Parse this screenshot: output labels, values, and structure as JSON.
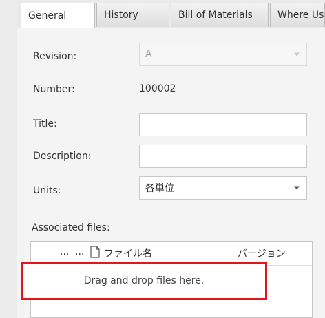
{
  "tabs": [
    "General",
    "History",
    "Bill of Materials",
    "Where Used"
  ],
  "form": {
    "revision_label": "Revision:",
    "revision_value": "A",
    "number_label": "Number:",
    "number_value": "100002",
    "title_label": "Title:",
    "title_value": "",
    "description_label": "Description:",
    "description_value": "",
    "units_label": "Units:",
    "units_value": "各単位"
  },
  "files": {
    "label": "Associated files:",
    "col_dots1": "...",
    "col_dots2": "...",
    "col_filename": "ファイル名",
    "col_version": "バージョン",
    "drop_text": "Drag and drop files here."
  },
  "colors": {
    "highlight": "#e8141b"
  }
}
